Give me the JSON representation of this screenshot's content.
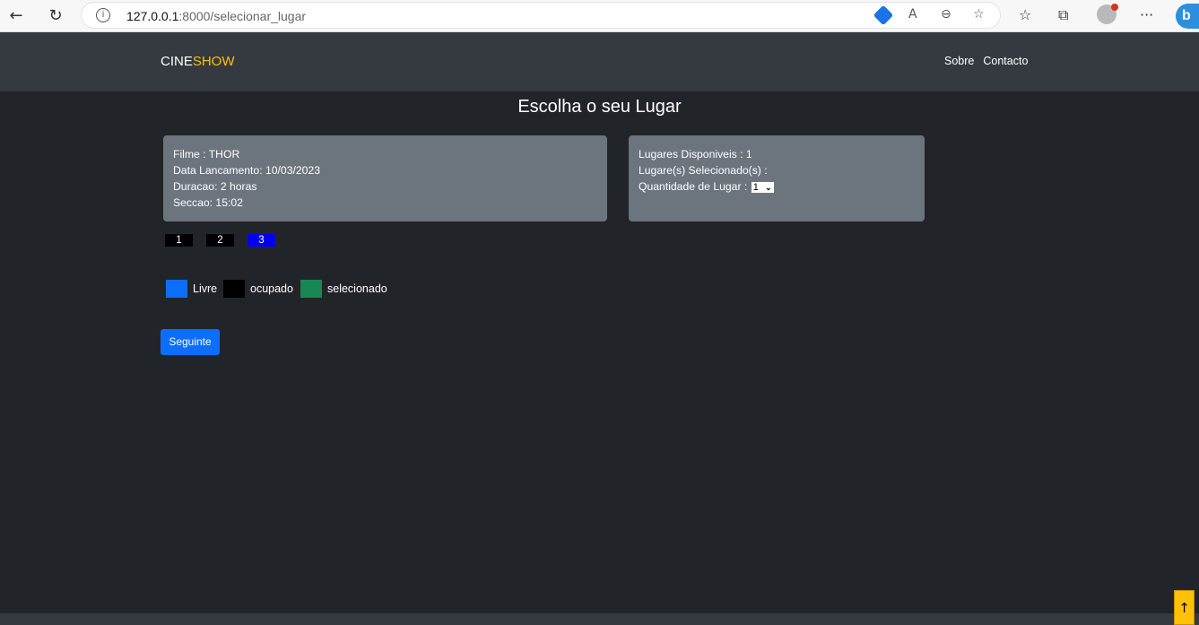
{
  "browser": {
    "url_host": "127.0.0.1",
    "url_rest": ":8000/selecionar_lugar",
    "icons": [
      "back-arrow-icon",
      "refresh-icon",
      "info-icon",
      "tag-icon",
      "read-aloud-icon",
      "zoom-icon",
      "add-favorite-icon",
      "favorites-icon",
      "collections-icon",
      "profile-avatar",
      "more-icon",
      "bing-icon"
    ]
  },
  "navbar": {
    "brand_part1": "CINE",
    "brand_part2": "SHOW",
    "links": [
      "Sobre",
      "Contacto"
    ]
  },
  "page": {
    "title": "Escolha o seu Lugar"
  },
  "movie_card": {
    "filme": "Filme : THOR",
    "data_lancamento": "Data Lancamento: 10/03/2023",
    "duracao": "Duracao: 2 horas",
    "seccao": "Seccao: 15:02"
  },
  "seat_card": {
    "disponiveis": "Lugares Disponiveis : 1",
    "selecionados": "Lugare(s) Selecionado(s) :",
    "quantidade_label": "Quantidade de Lugar :",
    "quantidade_value": "1"
  },
  "seats": [
    {
      "label": "1",
      "status": "ocupado"
    },
    {
      "label": "2",
      "status": "ocupado"
    },
    {
      "label": "3",
      "status": "selected"
    }
  ],
  "legend": {
    "livre": "Livre",
    "ocupado": "ocupado",
    "selecionado": "selecionado",
    "colors": {
      "livre": "#0d6efd",
      "ocupado": "#000000",
      "selecionado": "#198754"
    }
  },
  "actions": {
    "next": "Seguinte"
  },
  "scroll_top_icon": "↑"
}
